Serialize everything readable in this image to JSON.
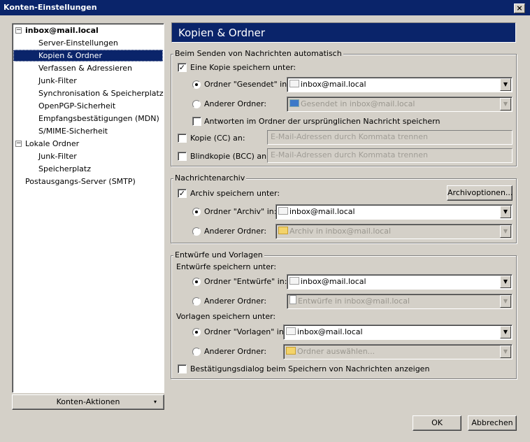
{
  "window": {
    "title": "Konten-Einstellungen",
    "close": "×"
  },
  "tree": {
    "items": [
      {
        "label": "inbox@mail.local",
        "level": 0,
        "bold": true,
        "expander": "−"
      },
      {
        "label": "Server-Einstellungen",
        "level": 1
      },
      {
        "label": "Kopien & Ordner",
        "level": 1,
        "selected": true
      },
      {
        "label": "Verfassen & Adressieren",
        "level": 1
      },
      {
        "label": "Junk-Filter",
        "level": 1
      },
      {
        "label": "Synchronisation & Speicherplatz",
        "level": 1
      },
      {
        "label": "OpenPGP-Sicherheit",
        "level": 1
      },
      {
        "label": "Empfangsbestätigungen (MDN)",
        "level": 1
      },
      {
        "label": "S/MIME-Sicherheit",
        "level": 1
      },
      {
        "label": "Lokale Ordner",
        "level": 0,
        "expander": "−"
      },
      {
        "label": "Junk-Filter",
        "level": 1
      },
      {
        "label": "Speicherplatz",
        "level": 1
      },
      {
        "label": "Postausgangs-Server (SMTP)",
        "level": 0
      }
    ],
    "actions_button": "Konten-Aktionen",
    "actions_arrow": "▾"
  },
  "page": {
    "title": "Kopien & Ordner"
  },
  "sending": {
    "legend": "Beim Senden von Nachrichten automatisch",
    "save_copy": {
      "label": "Eine Kopie speichern unter:",
      "checked": true
    },
    "sent_folder": {
      "label": "Ordner \"Gesendet\" in:",
      "value": "inbox@mail.local",
      "selected": true
    },
    "other_folder": {
      "label": "Anderer Ordner:",
      "value": "Gesendet in inbox@mail.local"
    },
    "replies": {
      "label": "Antworten im Ordner der ursprünglichen Nachricht speichern",
      "checked": false
    },
    "cc": {
      "label": "Kopie (CC) an:",
      "placeholder": "E-Mail-Adressen durch Kommata trennen",
      "checked": false
    },
    "bcc": {
      "label": "Blindkopie (BCC) an:",
      "placeholder": "E-Mail-Adressen durch Kommata trennen",
      "checked": false
    }
  },
  "archive": {
    "legend": "Nachrichtenarchiv",
    "save": {
      "label": "Archiv speichern unter:",
      "checked": true
    },
    "options_button": "Archivoptionen...",
    "archive_folder": {
      "label": "Ordner \"Archiv\" in:",
      "value": "inbox@mail.local",
      "selected": true
    },
    "other_folder": {
      "label": "Anderer Ordner:",
      "value": "Archiv in inbox@mail.local"
    }
  },
  "drafts": {
    "legend": "Entwürfe und Vorlagen",
    "drafts_heading": "Entwürfe speichern unter:",
    "drafts_folder": {
      "label": "Ordner \"Entwürfe\" in:",
      "value": "inbox@mail.local",
      "selected": true
    },
    "drafts_other": {
      "label": "Anderer Ordner:",
      "value": "Entwürfe in inbox@mail.local"
    },
    "templates_heading": "Vorlagen speichern unter:",
    "templates_folder": {
      "label": "Ordner \"Vorlagen\" in:",
      "value": "inbox@mail.local",
      "selected": true
    },
    "templates_other": {
      "label": "Anderer Ordner:",
      "value": "Ordner auswählen..."
    },
    "confirm": {
      "label": "Bestätigungsdialog beim Speichern von Nachrichten anzeigen",
      "checked": false
    }
  },
  "buttons": {
    "ok": "OK",
    "cancel": "Abbrechen"
  },
  "icons": {
    "check": "✓",
    "arrow": "▼"
  }
}
